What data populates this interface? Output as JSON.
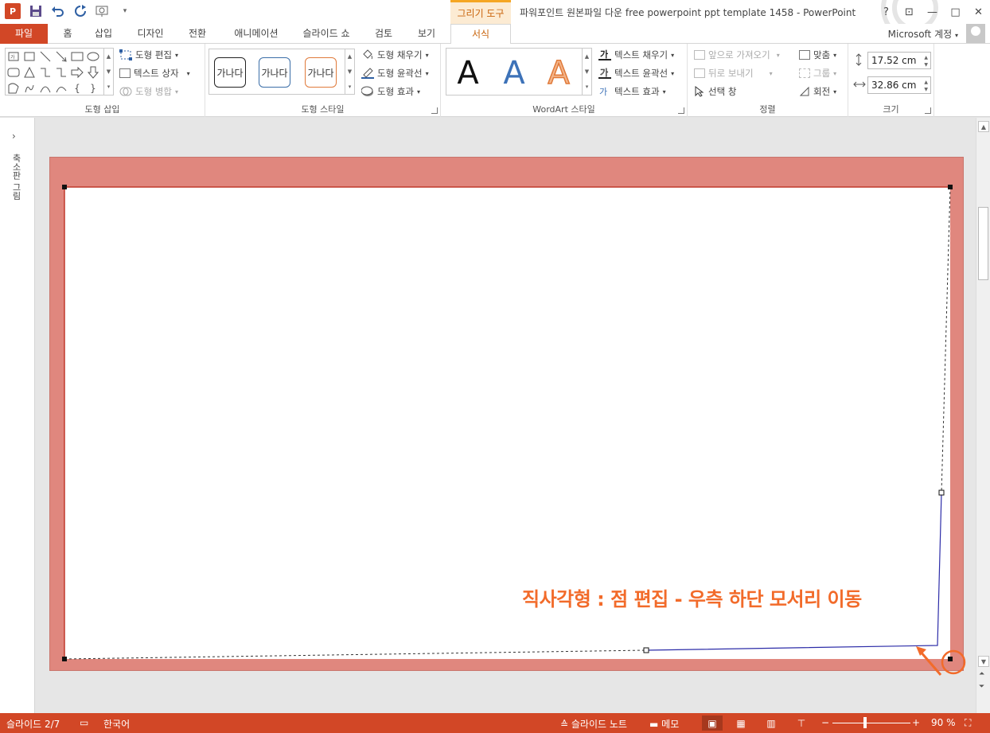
{
  "quick_access": {
    "app_icon": "P",
    "save_icon": "save-icon",
    "undo_icon": "undo-icon",
    "redo_icon": "redo-icon"
  },
  "title_bar": {
    "context_tab": "그리기 도구",
    "title": "파워포인트 원본파일 다운 free powerpoint ppt template 1458 - PowerPoint",
    "help": "?",
    "minimize": "—",
    "restore": "□",
    "close": "✕"
  },
  "tabs": [
    "파일",
    "홈",
    "삽입",
    "디자인",
    "전환",
    "애니메이션",
    "슬라이드 쇼",
    "검토",
    "보기",
    "서식"
  ],
  "active_tab": "서식",
  "account": "Microsoft 계정",
  "ribbon": {
    "insert_shapes": {
      "label": "도형 삽입",
      "edit_shape": "도형 편집",
      "text_box": "텍스트 상자",
      "merge_shapes": "도형 병합"
    },
    "shape_styles": {
      "label": "도형 스타일",
      "samples": [
        "가나다",
        "가나다",
        "가나다"
      ],
      "fill": "도형 채우기",
      "outline": "도형 윤곽선",
      "effects": "도형 효과"
    },
    "wordart": {
      "label": "WordArt 스타일",
      "samples": [
        "A",
        "A",
        "A"
      ],
      "text_fill": "텍스트 채우기",
      "text_outline": "텍스트 윤곽선",
      "text_effects": "텍스트 효과"
    },
    "arrange": {
      "label": "정렬",
      "bring_forward": "앞으로 가져오기",
      "send_backward": "뒤로 보내기",
      "selection_pane": "선택 창",
      "align": "맞춤",
      "group": "그룹",
      "rotate": "회전"
    },
    "size": {
      "label": "크기",
      "height": "17.52 cm",
      "width": "32.86 cm"
    }
  },
  "thumbnail_pane": {
    "label": "축소판 그림",
    "expand_icon": "chevron-right-icon"
  },
  "slide": {
    "caption": "직사각형 : 점 편집 - 우측 하단 모서리 이동"
  },
  "status_bar": {
    "slide_info": "슬라이드 2/7",
    "language": "한국어",
    "notes": "슬라이드 노트",
    "comments": "메모",
    "zoom": "90 %",
    "zoom_minus": "−",
    "zoom_plus": "+"
  },
  "colors": {
    "accent": "#d24726",
    "context_tab": "#c9640c",
    "slide_frame": "#e0877e",
    "caption": "#f26b2a"
  }
}
